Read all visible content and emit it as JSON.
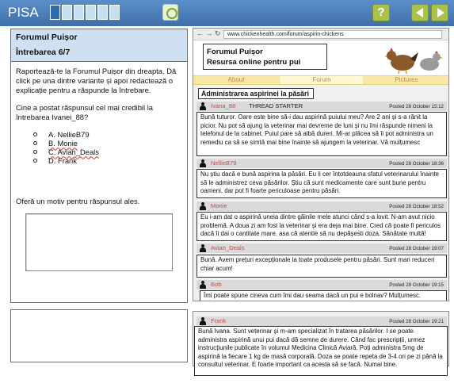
{
  "header": {
    "brand": "PISA",
    "progress_total": 6,
    "progress_done": 1,
    "help_label": "?"
  },
  "question": {
    "unit_title": "Forumul Puișor",
    "item_title": "Întrebarea 6/7",
    "instruction": "Raportează-te la Forumul Puișor din dreapta. Dă click pe una dintre variante și apoi redactează o explicație pentru a răspunde la întrebare.",
    "prompt": "Cine a postat răspunsul cel mai credibil la întrebarea Ivanei_88?",
    "options": [
      {
        "label": "A. NellieB79"
      },
      {
        "label": "B. Monie"
      },
      {
        "label": "C. Avian_Deals"
      },
      {
        "label": "D. Frank"
      }
    ],
    "explain_prompt": "Oferă un motiv pentru răspunsul ales."
  },
  "browser": {
    "nav_arrows": "← → ↻",
    "url": "www.chickenhealth.com/forum/aspirin-chickens",
    "site_title_line1": "Forumul Puișor",
    "site_title_line2": "Resursa online pentru pui",
    "tabs": [
      "About",
      "Forum",
      "Pictures"
    ],
    "active_tab": "Forum",
    "section_title": "Administrarea aspirinei la păsări"
  },
  "posts": [
    {
      "user": "Ivana_88",
      "tag": "THREAD STARTER",
      "date": "Posted 28 October 15:12",
      "text": "Bună tuturor. Oare este bine să-i dau aspirină puiului meu? Are 2 ani și s-a rănit la picior. Nu pot să ajung la veterinar mai devreme de luni și nu îmi răspunde nimeni la telefonul de la cabinet. Puiul pare să aibă dureri. Mi-ar plăcea să îi pot administra un remediu ca să se simtă mai bine înainte să ajungem la veterinar. Vă mulțumesc"
    },
    {
      "user": "NellieB79",
      "tag": "",
      "date": "Posted 28 October 18:36",
      "text": "Nu știu dacă e bună aspirina la păsări. Eu li cer întotdeauna sfatul veterinarului înainte să le administrez ceva păsărilor. Știu că sunt medicamente care sunt bune pentru oameni, dar pot fi foarte periculoase pentru păsări."
    },
    {
      "user": "Monie",
      "tag": "",
      "date": "Posted 28 October 18:52",
      "text": "Eu i-am dat o aspirină uneia dintre găinile mele atunci când s-a lovit. N-am avut nicio problemă. A doua zi am fost la veterinar și era deja mai bine. Cred că poate fi periculos dacă îi dai o cantitate mare. asa că atentie să nu depășesti doza. Sănătate multă!"
    },
    {
      "user": "Avian_Deals",
      "tag": "",
      "date": "Posted 28 October 19:07",
      "text": "Bună. Avem prețuri excepționale la toate produsele pentru păsări. Sunt mari reduceri chiar acum!"
    },
    {
      "user": "Bob",
      "tag": "",
      "date": "Posted 28 October 19:15",
      "text": "Îmi poate spune cineva cum îmi dau seama dacă un pui e bolnav? Mulțumesc."
    },
    {
      "user": "Frank",
      "tag": "",
      "date": "Posted 28 October 19:21",
      "text": "Bună Ivana. Sunt veterinar și m-am specializat în tratarea păsărilor. I se poate administra aspirină unui pui dacă dă semne de durere. Când fac prescripții, urmez instrucțiunile publicate în volumul Medicina Clinică Aviară. Poți administra 5mg de aspirină la fiecare 1 kg de masă corporală. Doza se poate repeta de 3-4 ori pe zi până la consultul veterinar. E foarte important ca acesta să se facă. Numai bine."
    }
  ]
}
